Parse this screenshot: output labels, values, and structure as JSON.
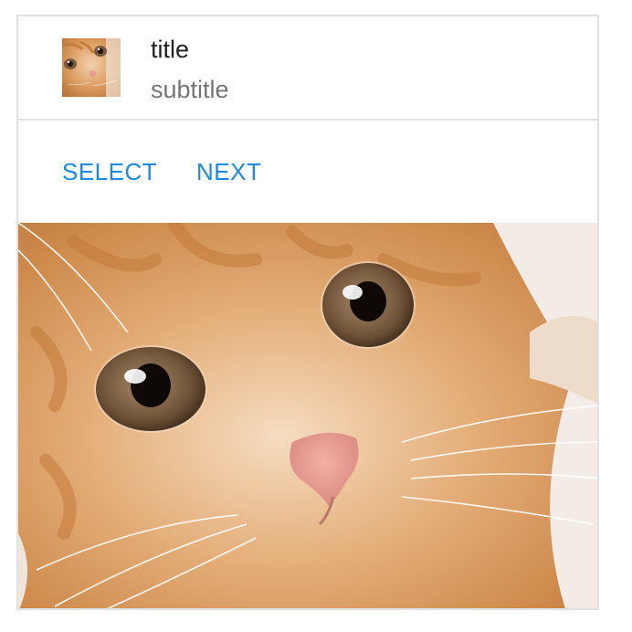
{
  "card": {
    "title": "title",
    "subtitle": "subtitle",
    "avatar_icon": "kitten-thumbnail",
    "actions": [
      {
        "label": "SELECT"
      },
      {
        "label": "NEXT"
      }
    ],
    "media_icon": "kitten-photo"
  },
  "colors": {
    "accent": "#1e88e5",
    "border": "#e2e2e2",
    "title_text": "#222222",
    "subtitle_text": "#757575"
  }
}
